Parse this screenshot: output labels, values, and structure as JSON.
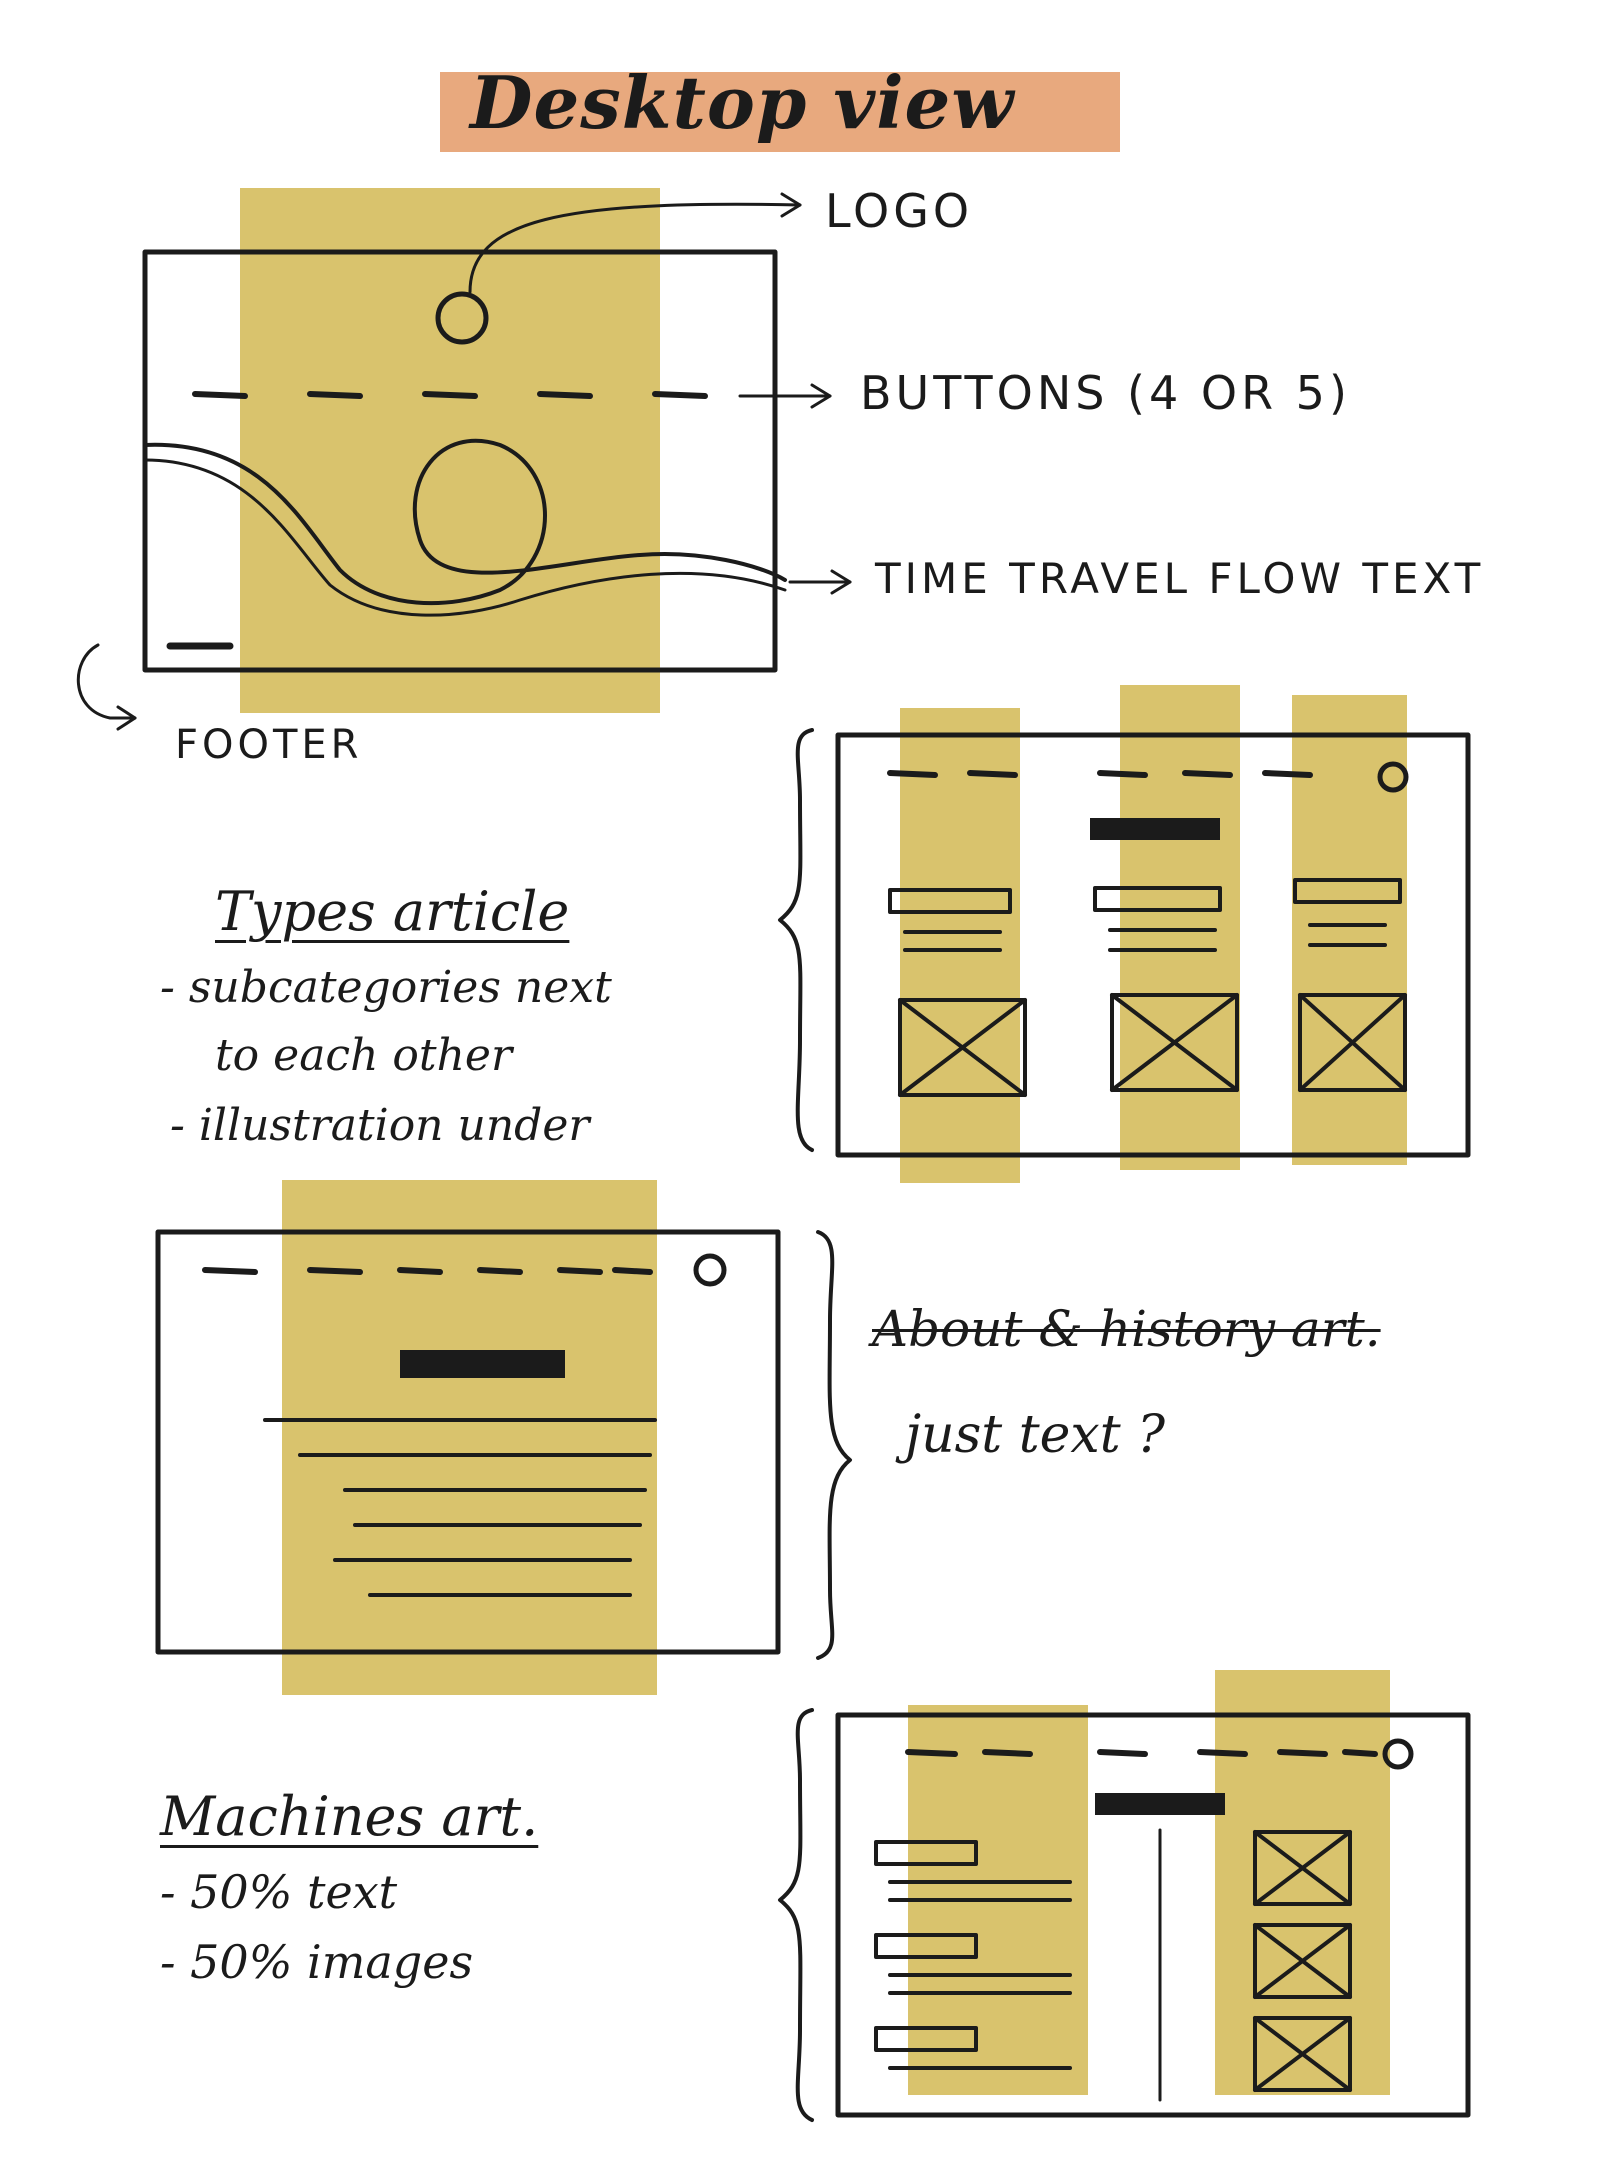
{
  "colors": {
    "title_highlight": "#e8a97e",
    "column_highlight": "#d9c36d",
    "ink": "#1b1b1b"
  },
  "title": "Desktop view",
  "home": {
    "logo_label": "LOGO",
    "buttons_label": "BUTTONS (4 OR 5)",
    "flow_label": "TIME TRAVEL FLOW TEXT",
    "footer_label": "FOOTER"
  },
  "types_article": {
    "heading": "Types article",
    "notes": [
      "- subcategories next",
      "to each other",
      "- illustration under"
    ]
  },
  "about_article": {
    "heading": "About & history art.",
    "note": "just text ?"
  },
  "machines_article": {
    "heading": "Machines art.",
    "notes": [
      "- 50% text",
      "- 50% images"
    ]
  }
}
